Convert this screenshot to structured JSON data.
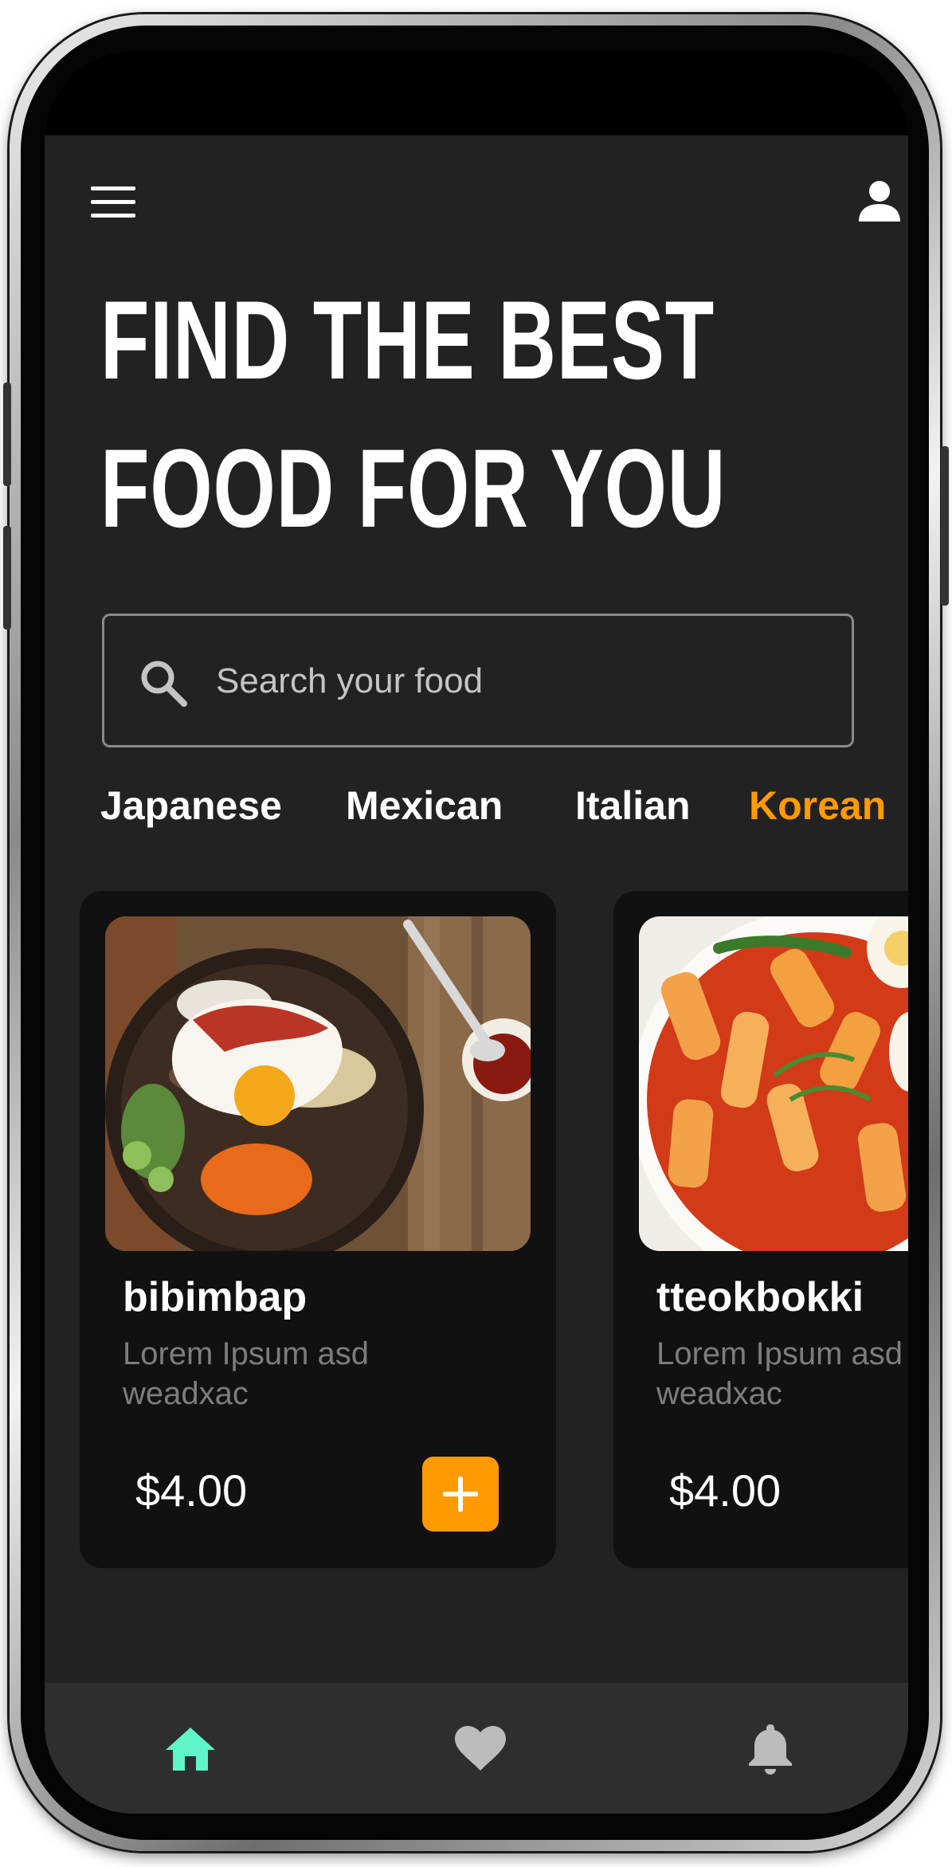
{
  "header": {
    "menu_icon": "hamburger-menu-icon",
    "profile_icon": "user-profile-icon",
    "title_line1": "FIND THE BEST",
    "title_line2": "FOOD FOR YOU"
  },
  "search": {
    "icon": "search-icon",
    "placeholder": "Search your food",
    "value": ""
  },
  "categories": [
    {
      "label": "Japanese",
      "active": false
    },
    {
      "label": "Mexican",
      "active": false
    },
    {
      "label": "Italian",
      "active": false
    },
    {
      "label": "Korean",
      "active": true
    }
  ],
  "foods": [
    {
      "name": "bibimbap",
      "description_line1": "Lorem Ipsum asd",
      "description_line2": "weadxac",
      "price": "$4.00"
    },
    {
      "name": "tteokbokki",
      "description_line1": "Lorem Ipsum asd",
      "description_line2": "weadxac",
      "price": "$4.00"
    }
  ],
  "bottom_nav": [
    {
      "icon": "home-icon",
      "active": true
    },
    {
      "icon": "heart-icon",
      "active": false
    },
    {
      "icon": "bell-icon",
      "active": false
    }
  ],
  "colors": {
    "accent": "#ff9a00",
    "nav_active": "#5ff5c8",
    "background": "#222222",
    "card": "#111111"
  }
}
